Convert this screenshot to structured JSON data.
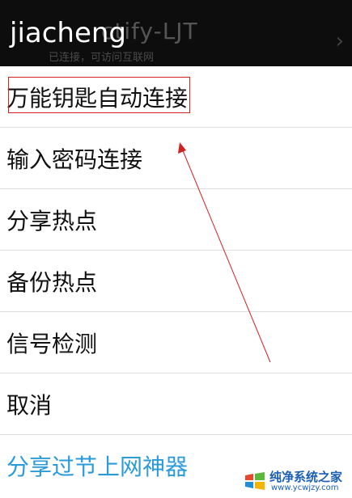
{
  "background": {
    "title": "ctify-LJT",
    "subtitle": "已连接，可访问互联网",
    "chevron": "›"
  },
  "dialog": {
    "title": "jiacheng"
  },
  "menu": {
    "items": [
      {
        "label": "万能钥匙自动连接"
      },
      {
        "label": "输入密码连接"
      },
      {
        "label": "分享热点"
      },
      {
        "label": "备份热点"
      },
      {
        "label": "信号检测"
      },
      {
        "label": "取消"
      },
      {
        "label": "分享过节上网神器"
      }
    ]
  },
  "watermark": {
    "title": "纯净系统之家",
    "url": "www.ycwjzy.com"
  },
  "colors": {
    "annotation": "#d02020",
    "accent": "#2b9bd8",
    "topbar": "#0d0d0d"
  }
}
